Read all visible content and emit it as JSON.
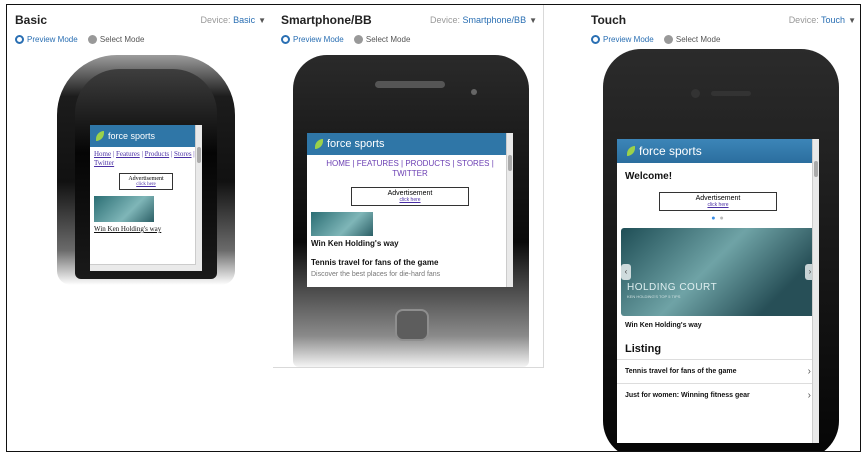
{
  "panels": [
    {
      "title": "Basic",
      "device_label": "Device:",
      "device_value": "Basic",
      "modes": {
        "preview": "Preview Mode",
        "select": "Select Mode"
      },
      "screen": {
        "brand": "force sports",
        "nav": [
          "Home",
          "Features",
          "Products",
          "Stores",
          "Twitter"
        ],
        "ad_title": "Advertisement",
        "ad_link": "click here",
        "story": "Win Ken Holding's way"
      }
    },
    {
      "title": "Smartphone/BB",
      "device_label": "Device:",
      "device_value": "Smartphone/BB",
      "modes": {
        "preview": "Preview Mode",
        "select": "Select Mode"
      },
      "screen": {
        "brand": "force sports",
        "nav": "HOME | FEATURES | PRODUCTS | STORES | TWITTER",
        "ad_title": "Advertisement",
        "ad_link": "click here",
        "story": "Win Ken Holding's way",
        "story2": "Tennis travel for fans of the game",
        "frag": "Discover the best places for die-hard fans"
      }
    },
    {
      "title": "Touch",
      "device_label": "Device:",
      "device_value": "Touch",
      "modes": {
        "preview": "Preview Mode",
        "select": "Select Mode"
      },
      "screen": {
        "brand": "force sports",
        "welcome": "Welcome!",
        "ad_title": "Advertisement",
        "ad_link": "click here",
        "hero_title": "HOLDING COURT",
        "hero_sub": "KEN HOLDING'S TOP 5 TIPS",
        "caption": "Win Ken Holding's way",
        "listing": "Listing",
        "rows": [
          "Tennis travel for fans of the game",
          "Just for women: Winning fitness gear"
        ]
      }
    }
  ],
  "icons": {
    "preview": "magnifier-icon",
    "select": "gear-icon",
    "caret": "caret-down-icon",
    "chevron": "chevron-right-icon"
  },
  "colors": {
    "accent": "#2a6fb3",
    "header": "#2f76a7",
    "nav_link": "#6b3fb3"
  }
}
